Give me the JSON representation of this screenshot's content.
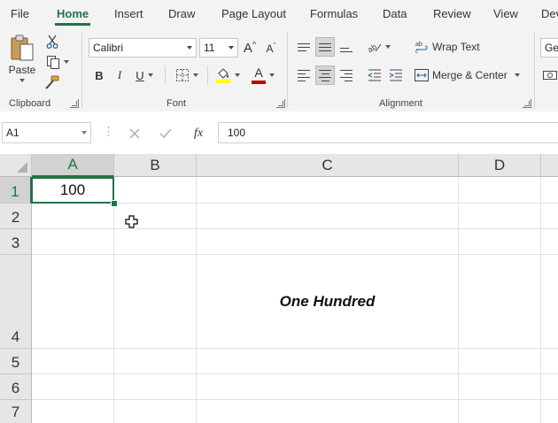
{
  "tabs": [
    "File",
    "Home",
    "Insert",
    "Draw",
    "Page Layout",
    "Formulas",
    "Data",
    "Review",
    "View",
    "Dev"
  ],
  "clipboard": {
    "paste_label": "Paste",
    "group_label": "Clipboard"
  },
  "font": {
    "name": "Calibri",
    "size": "11",
    "bold": "B",
    "italic": "I",
    "underline": "U",
    "grow": "A",
    "shrink": "A",
    "color_a": "A",
    "group_label": "Font"
  },
  "alignment": {
    "wrap_text": "Wrap Text",
    "merge_center": "Merge & Center",
    "group_label": "Alignment"
  },
  "number": {
    "format": "Ge"
  },
  "formula_bar": {
    "name_box": "A1",
    "fx": "fx",
    "value": "100"
  },
  "columns": [
    "A",
    "B",
    "C",
    "D"
  ],
  "rows": [
    "1",
    "2",
    "3",
    "4",
    "5",
    "6",
    "7"
  ],
  "cells": {
    "A1": "100",
    "C4": "One Hundred"
  },
  "colors": {
    "accent": "#217346",
    "font_color": "#c00000",
    "fill_color": "#ffff00"
  }
}
